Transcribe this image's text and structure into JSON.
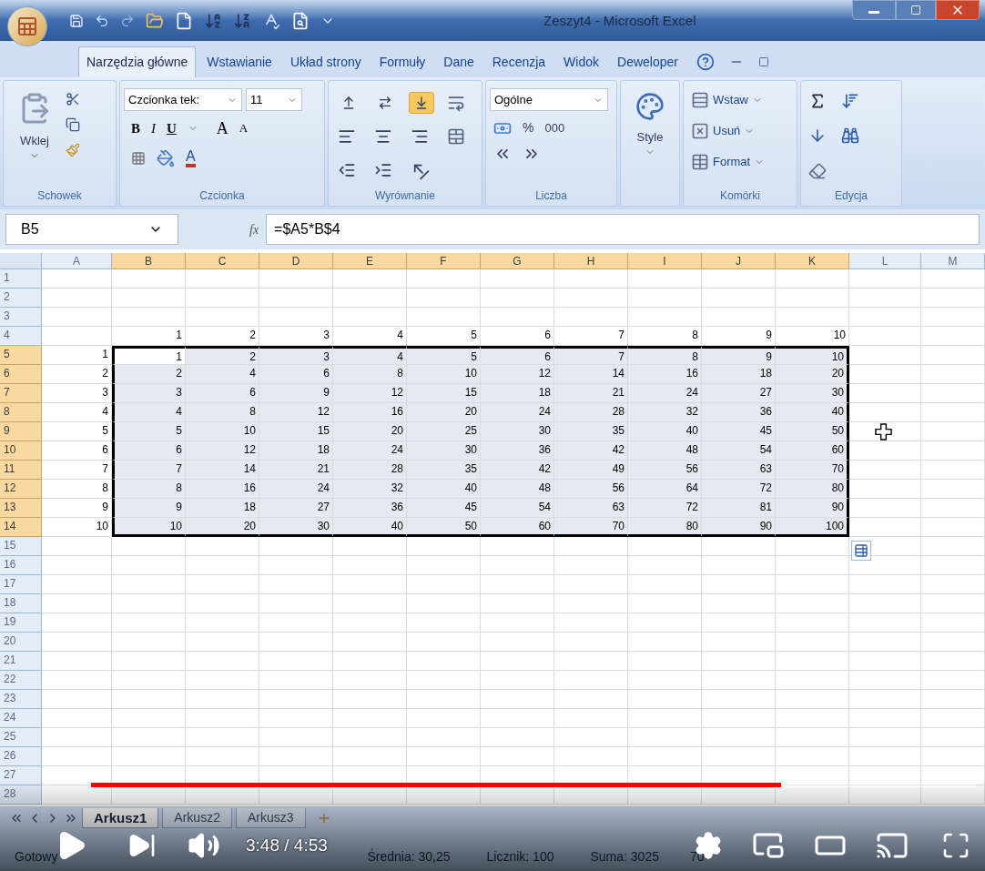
{
  "window": {
    "title": "Zeszyt4 - Microsoft Excel"
  },
  "ribbon_tabs": [
    {
      "label": "Narzędzia główne",
      "selected": true
    },
    {
      "label": "Wstawianie",
      "selected": false
    },
    {
      "label": "Układ strony",
      "selected": false
    },
    {
      "label": "Formuły",
      "selected": false
    },
    {
      "label": "Dane",
      "selected": false
    },
    {
      "label": "Recenzja",
      "selected": false
    },
    {
      "label": "Widok",
      "selected": false
    },
    {
      "label": "Deweloper",
      "selected": false
    }
  ],
  "clipboard": {
    "paste_label": "Wklej",
    "group": "Schowek"
  },
  "font": {
    "name": "Czcionka tek:",
    "size": "11",
    "bold": "B",
    "italic": "I",
    "underline": "U",
    "grow": "A",
    "shrink": "A",
    "color_letter": "A",
    "group": "Czcionka"
  },
  "alignment": {
    "vertical": [
      {
        "kind": "top",
        "on": false
      },
      {
        "kind": "middle",
        "on": false
      },
      {
        "kind": "bottom",
        "on": true
      }
    ],
    "group": "Wyrównanie"
  },
  "number": {
    "format": "Ogólne",
    "percent": "%",
    "thousands": "000",
    "group": "Liczba"
  },
  "styles": {
    "label": "Style"
  },
  "cells": {
    "buttons": [
      {
        "kind": "insert",
        "label": "Wstaw"
      },
      {
        "kind": "delete",
        "label": "Usuń"
      },
      {
        "kind": "format",
        "label": "Format"
      }
    ],
    "group": "Komórki"
  },
  "editing": {
    "group": "Edycja"
  },
  "formula_bar": {
    "name_box": "B5",
    "function_label": "fx",
    "formula": "=$A5*B$4"
  },
  "grid": {
    "columns": [
      {
        "label": "A",
        "selected": false
      },
      {
        "label": "B",
        "selected": true
      },
      {
        "label": "C",
        "selected": true
      },
      {
        "label": "D",
        "selected": true
      },
      {
        "label": "E",
        "selected": true
      },
      {
        "label": "F",
        "selected": true
      },
      {
        "label": "G",
        "selected": true
      },
      {
        "label": "H",
        "selected": true
      },
      {
        "label": "I",
        "selected": true
      },
      {
        "label": "J",
        "selected": true
      },
      {
        "label": "K",
        "selected": true
      },
      {
        "label": "L",
        "selected": false
      },
      {
        "label": "M",
        "selected": false
      }
    ],
    "rows": [
      {
        "header": "1",
        "selected": false
      },
      {
        "header": "2",
        "selected": false
      },
      {
        "header": "3",
        "selected": false
      },
      {
        "header": "4",
        "selected": false,
        "cells": [
          "1",
          "2",
          "3",
          "4",
          "5",
          "6",
          "7",
          "8",
          "9",
          "10"
        ]
      },
      {
        "header": "5",
        "selected": true,
        "a": "1",
        "cells": [
          "1",
          "2",
          "3",
          "4",
          "5",
          "6",
          "7",
          "8",
          "9",
          "10"
        ]
      },
      {
        "header": "6",
        "selected": true,
        "a": "2",
        "cells": [
          "2",
          "4",
          "6",
          "8",
          "10",
          "12",
          "14",
          "16",
          "18",
          "20"
        ]
      },
      {
        "header": "7",
        "selected": true,
        "a": "3",
        "cells": [
          "3",
          "6",
          "9",
          "12",
          "15",
          "18",
          "21",
          "24",
          "27",
          "30"
        ]
      },
      {
        "header": "8",
        "selected": true,
        "a": "4",
        "cells": [
          "4",
          "8",
          "12",
          "16",
          "20",
          "24",
          "28",
          "32",
          "36",
          "40"
        ]
      },
      {
        "header": "9",
        "selected": true,
        "a": "5",
        "cells": [
          "5",
          "10",
          "15",
          "20",
          "25",
          "30",
          "35",
          "40",
          "45",
          "50"
        ]
      },
      {
        "header": "10",
        "selected": true,
        "a": "6",
        "cells": [
          "6",
          "12",
          "18",
          "24",
          "30",
          "36",
          "42",
          "48",
          "54",
          "60"
        ]
      },
      {
        "header": "11",
        "selected": true,
        "a": "7",
        "cells": [
          "7",
          "14",
          "21",
          "28",
          "35",
          "42",
          "49",
          "56",
          "63",
          "70"
        ]
      },
      {
        "header": "12",
        "selected": true,
        "a": "8",
        "cells": [
          "8",
          "16",
          "24",
          "32",
          "40",
          "48",
          "56",
          "64",
          "72",
          "80"
        ]
      },
      {
        "header": "13",
        "selected": true,
        "a": "9",
        "cells": [
          "9",
          "18",
          "27",
          "36",
          "45",
          "54",
          "63",
          "72",
          "81",
          "90"
        ]
      },
      {
        "header": "14",
        "selected": true,
        "a": "10",
        "cells": [
          "10",
          "20",
          "30",
          "40",
          "50",
          "60",
          "70",
          "80",
          "90",
          "100"
        ]
      },
      {
        "header": "15",
        "selected": false
      },
      {
        "header": "16",
        "selected": false
      },
      {
        "header": "17",
        "selected": false
      },
      {
        "header": "18",
        "selected": false
      },
      {
        "header": "19",
        "selected": false
      },
      {
        "header": "20",
        "selected": false
      },
      {
        "header": "21",
        "selected": false
      },
      {
        "header": "22",
        "selected": false
      },
      {
        "header": "23",
        "selected": false
      },
      {
        "header": "24",
        "selected": false
      },
      {
        "header": "25",
        "selected": false
      },
      {
        "header": "26",
        "selected": false
      },
      {
        "header": "27",
        "selected": false
      },
      {
        "header": "28",
        "selected": false
      }
    ]
  },
  "sheet_tabs": [
    {
      "label": "Arkusz1",
      "selected": true
    },
    {
      "label": "Arkusz2",
      "selected": false
    },
    {
      "label": "Arkusz3",
      "selected": false
    }
  ],
  "status_bar": {
    "state": "Gotowy",
    "average": "Średnia: 30,25",
    "count": "Licznik: 100",
    "sum": "Suma: 3025",
    "zoom": "70"
  },
  "player": {
    "level": 0.78,
    "time": "3:48 / 4:53"
  }
}
